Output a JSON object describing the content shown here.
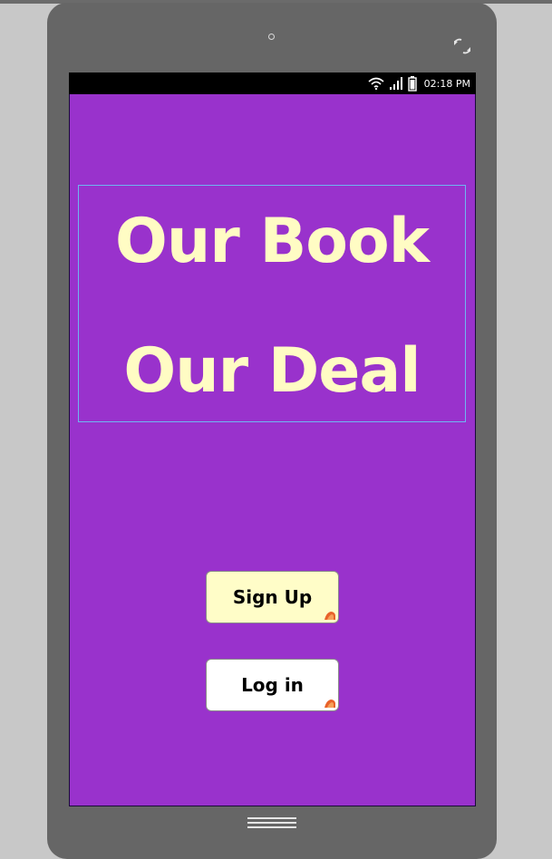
{
  "device": {
    "camera_icon": "camera-dot-icon",
    "rotate_icon": "rotate-icon",
    "home_icon": "home-menu-icon"
  },
  "status_bar": {
    "icons": [
      "wifi-icon",
      "signal-icon",
      "battery-icon"
    ],
    "time": "02:18 PM"
  },
  "screen": {
    "background_color": "#9932cc",
    "title": {
      "line1": "Our Book",
      "line2": "Our Deal",
      "color": "#fffcc4"
    },
    "buttons": {
      "signup": {
        "label": "Sign Up",
        "background": "#fffdc8"
      },
      "login": {
        "label": "Log in",
        "background": "#ffffff"
      }
    }
  }
}
